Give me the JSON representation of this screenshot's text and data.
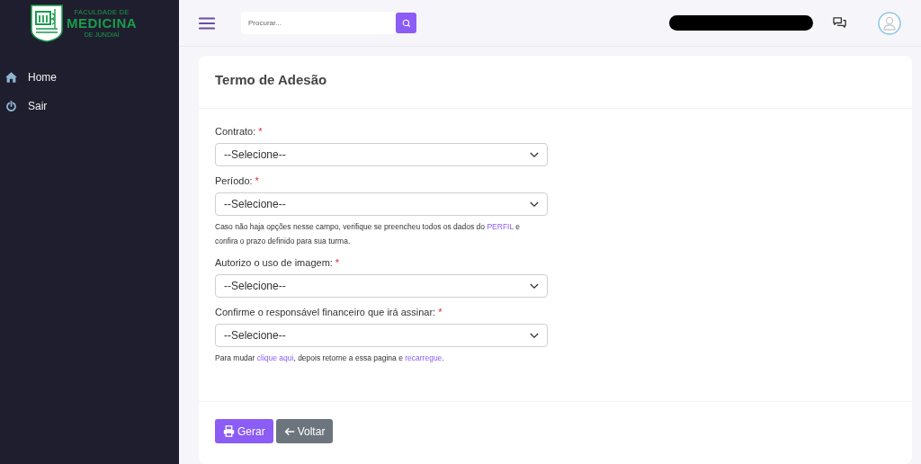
{
  "logo": {
    "lines": [
      "FACULDADE DE",
      "MEDICINA",
      "DE JUNDIAÍ"
    ]
  },
  "sidebar": {
    "items": [
      {
        "label": "Home",
        "kind": "home"
      },
      {
        "label": "Sair",
        "kind": "power"
      }
    ]
  },
  "topbar": {
    "search": {
      "placeholder": "Procurar..."
    }
  },
  "card": {
    "title": "Termo de Adesão",
    "fields": [
      {
        "label": "Contrato:",
        "required_mark": "*",
        "value": "--Selecione--"
      },
      {
        "label": "Período:",
        "required_mark": "*",
        "value": "--Selecione--",
        "help": [
          {
            "text": "Caso não haja opções nesse campo, verifique se preencheu todos os dados do "
          },
          {
            "link": "PERFIL"
          },
          {
            "text": " e confira o prazo definido para sua turma."
          }
        ]
      },
      {
        "label": "Autorizo o uso de imagem:",
        "required_mark": "*",
        "value": "--Selecione--"
      },
      {
        "label": "Confirme o responsável financeiro que irá assinar:",
        "required_mark": "*",
        "value": "--Selecione--",
        "help": [
          {
            "text": "Para mudar "
          },
          {
            "link": "clique aqui"
          },
          {
            "text": ", depois retorne a essa pagina e "
          },
          {
            "link": "recarregue"
          },
          {
            "text": "."
          }
        ]
      }
    ],
    "buttons": [
      {
        "label": "Gerar",
        "kind": "primary"
      },
      {
        "label": "Voltar",
        "kind": "secondary"
      }
    ]
  }
}
